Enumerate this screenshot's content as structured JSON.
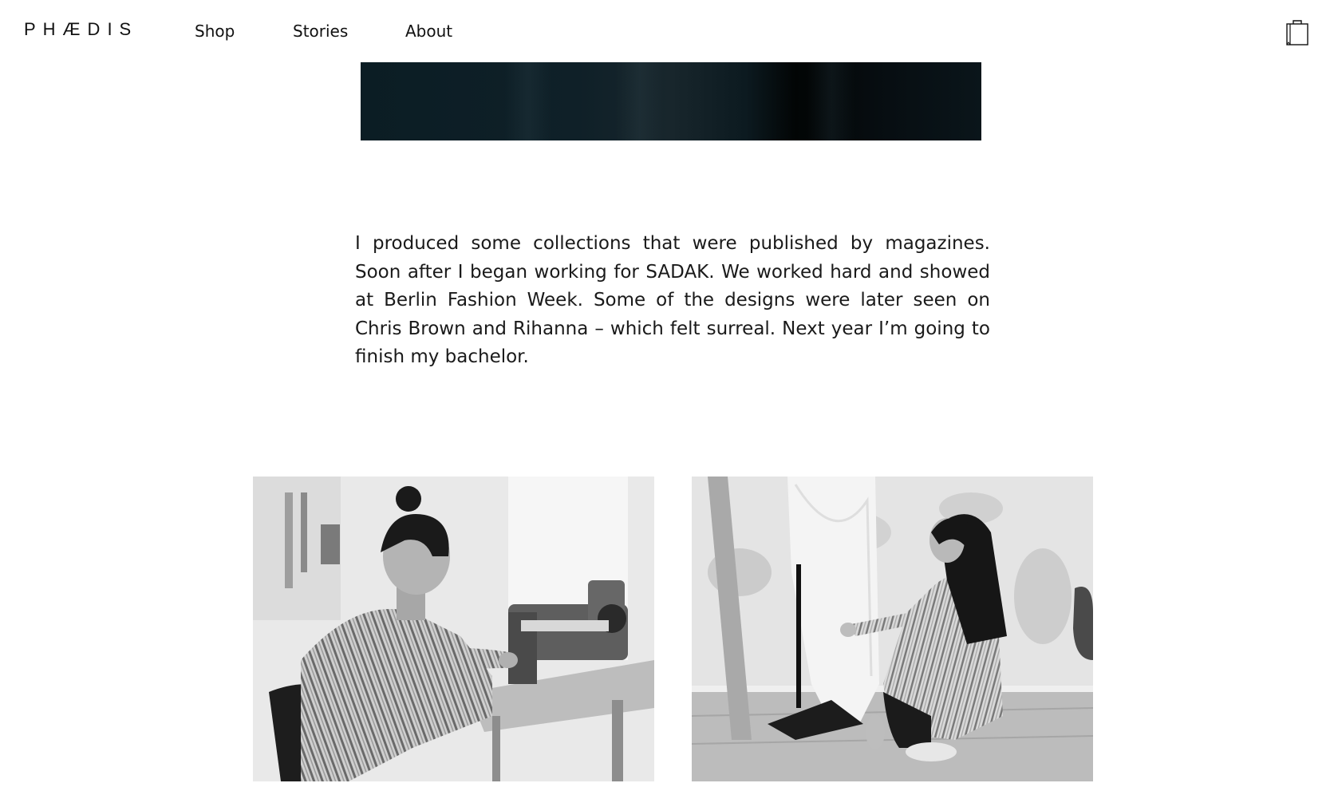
{
  "header": {
    "logo": "PHÆDIS",
    "nav": [
      {
        "label": "Shop"
      },
      {
        "label": "Stories"
      },
      {
        "label": "About"
      }
    ],
    "cart_icon": "shopping-bag-icon"
  },
  "story": {
    "paragraph": "I produced some collections that were published by magazines. Soon after I began working for SADAK. We worked hard and showed at Berlin Fashion Week. Some of the designs were later seen on Chris Brown and Rihanna – which felt surreal. Next year I’m going to finish my bachelor."
  },
  "photos": [
    {
      "subject": "man-at-sewing-machine-photo"
    },
    {
      "subject": "woman-crouching-with-garment-photo"
    }
  ]
}
